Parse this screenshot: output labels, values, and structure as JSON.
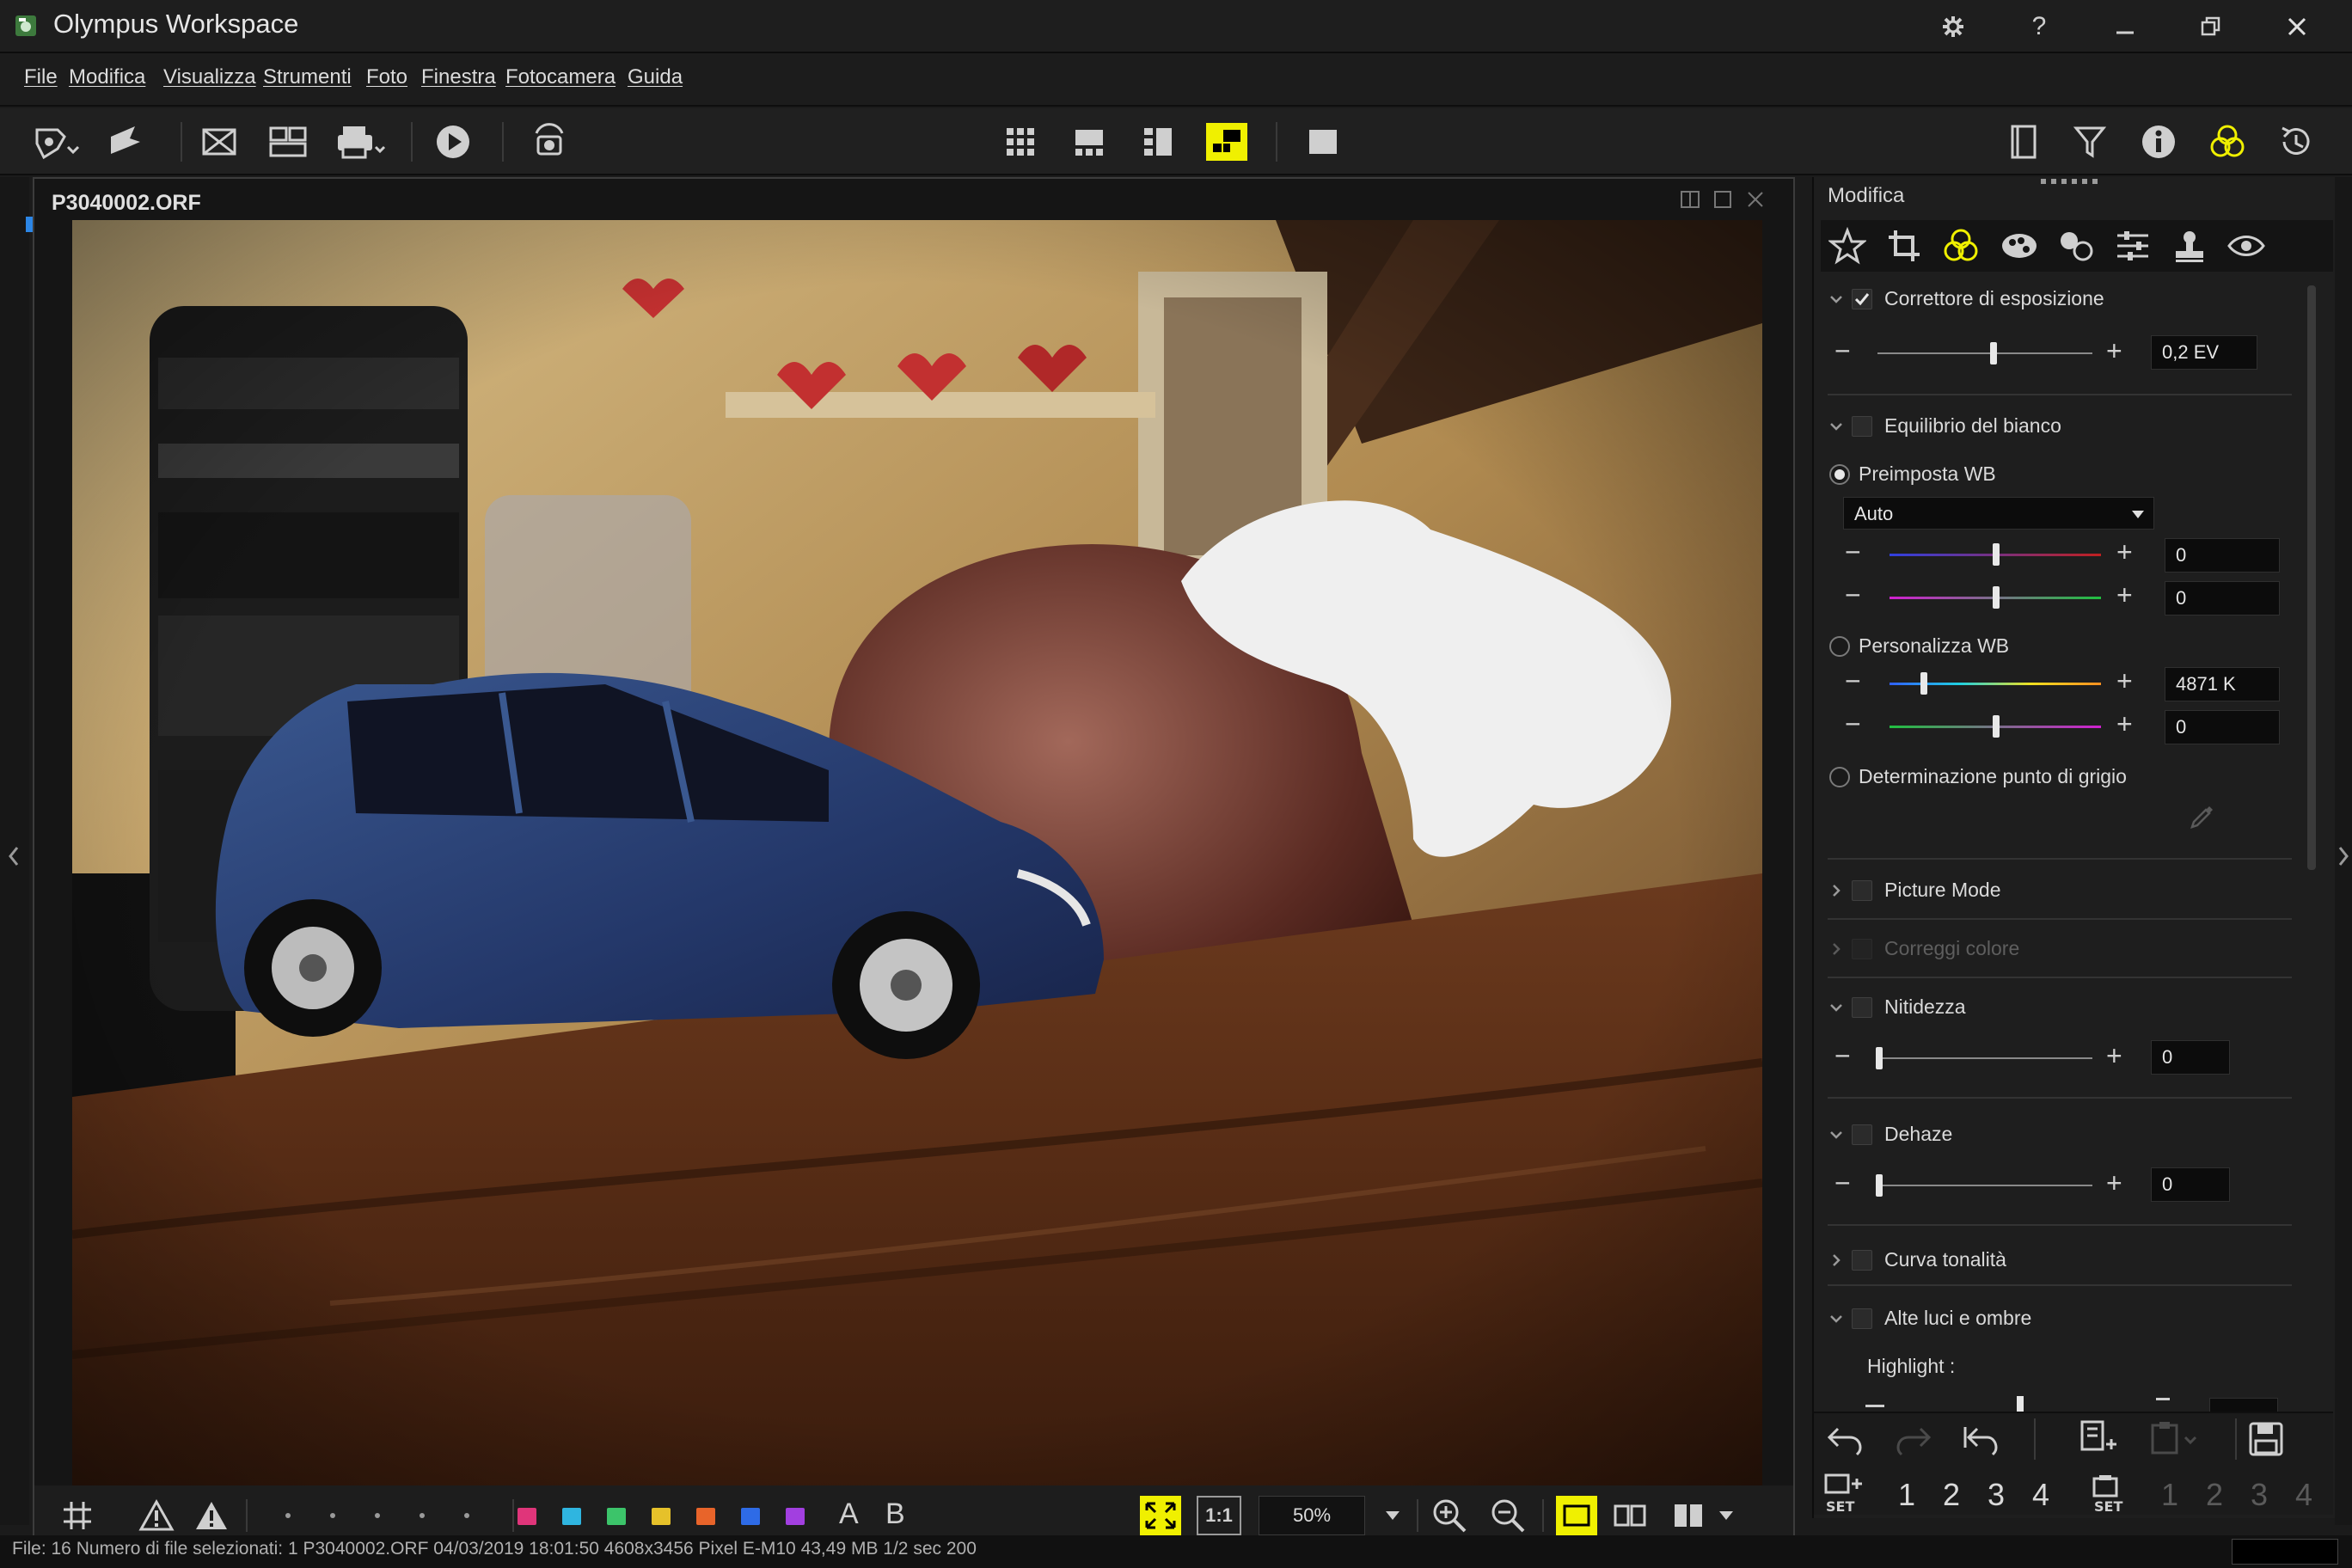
{
  "window": {
    "title": "Olympus Workspace"
  },
  "menu": [
    "File",
    "Modifica",
    "Visualizza",
    "Strumenti",
    "Foto",
    "Finestra",
    "Fotocamera",
    "Guida"
  ],
  "viewer": {
    "filename": "P3040002.ORF",
    "zoom": "50%",
    "labels": {
      "a": "A",
      "b": "B",
      "one_to_one": "1:1"
    }
  },
  "status": {
    "text": "File: 16 Numero di file selezionati: 1 P3040002.ORF 04/03/2019 18:01:50 4608x3456 Pixel E-M10 43,49 MB 1/2 sec 200"
  },
  "panel": {
    "title": "Modifica",
    "exposure": {
      "label": "Correttore di esposizione",
      "checked": true,
      "value": "0,2 EV",
      "level": 0.55
    },
    "wb": {
      "label": "Equilibrio del bianco",
      "preset_label": "Preimposta WB",
      "preset_value": "Auto",
      "preset_slider1": "0",
      "preset_slider2": "0",
      "custom_label": "Personalizza WB",
      "custom_kelvin": "4871 K",
      "custom_slider2": "0",
      "grey_label": "Determinazione punto di grigio"
    },
    "picture_mode": {
      "label": "Picture Mode"
    },
    "color_correct": {
      "label": "Correggi colore"
    },
    "sharpness": {
      "label": "Nitidezza",
      "value": "0"
    },
    "dehaze": {
      "label": "Dehaze",
      "value": "0"
    },
    "tone_curve": {
      "label": "Curva tonalità"
    },
    "highlights": {
      "label": "Alte luci e ombre",
      "highlight_label": "Highlight :"
    },
    "set_numbers": [
      "1",
      "2",
      "3",
      "4"
    ],
    "set_numbers2": [
      "1",
      "2",
      "3",
      "4"
    ]
  },
  "colors": {
    "active_accent": "#f0f000",
    "swatches": [
      "#e0357a",
      "#2fb5e0",
      "#3cc46a",
      "#e6c12a",
      "#e8642a",
      "#2e6be6",
      "#a23fe0"
    ]
  }
}
